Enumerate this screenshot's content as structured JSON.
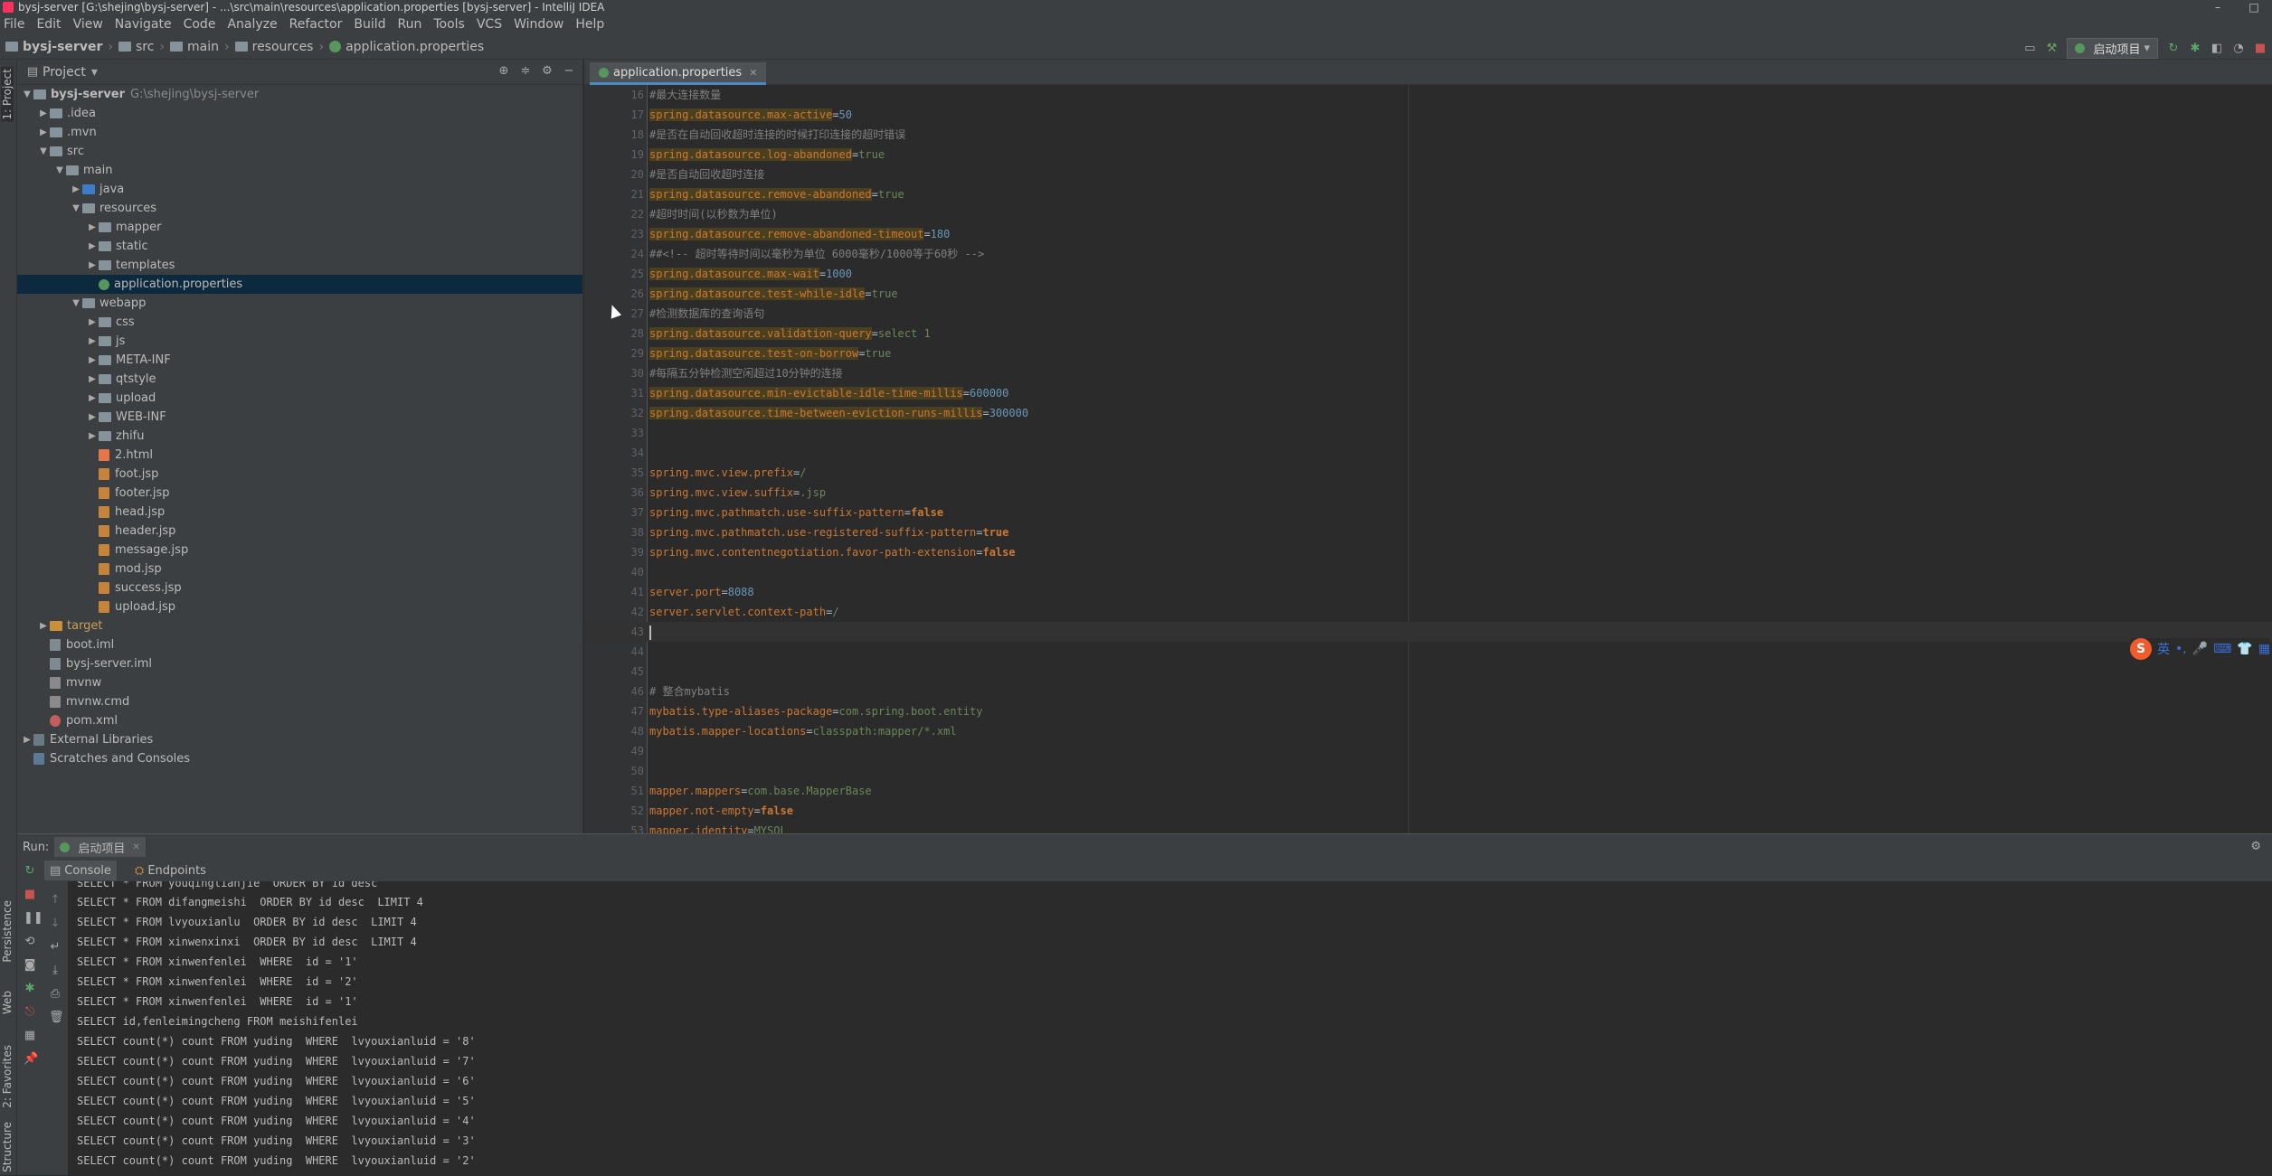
{
  "window": {
    "title": "bysj-server [G:\\shejing\\bysj-server] - ...\\src\\main\\resources\\application.properties [bysj-server] - IntelliJ IDEA",
    "min": "–",
    "close": "□"
  },
  "menu": [
    "File",
    "Edit",
    "View",
    "Navigate",
    "Code",
    "Analyze",
    "Refactor",
    "Build",
    "Run",
    "Tools",
    "VCS",
    "Window",
    "Help"
  ],
  "breadcrumb": [
    "bysj-server",
    "src",
    "main",
    "resources",
    "application.properties"
  ],
  "run_config": "启动项目",
  "left_tools": [
    "1: Project",
    "Persistence",
    "Web",
    "2: Favorites",
    "Structure"
  ],
  "project_panel": {
    "title": "Project",
    "tree": [
      {
        "name": "bysj-server",
        "path": "G:\\shejing\\bysj-server",
        "indent": 0,
        "type": "root"
      },
      {
        "name": ".idea",
        "indent": 1,
        "type": "folder"
      },
      {
        "name": ".mvn",
        "indent": 1,
        "type": "folder"
      },
      {
        "name": "src",
        "indent": 1,
        "type": "folder-open"
      },
      {
        "name": "main",
        "indent": 2,
        "type": "folder-open"
      },
      {
        "name": "java",
        "indent": 3,
        "type": "folder-blue"
      },
      {
        "name": "resources",
        "indent": 3,
        "type": "folder-open"
      },
      {
        "name": "mapper",
        "indent": 4,
        "type": "folder"
      },
      {
        "name": "static",
        "indent": 4,
        "type": "folder"
      },
      {
        "name": "templates",
        "indent": 4,
        "type": "folder-leaf"
      },
      {
        "name": "application.properties",
        "indent": 4,
        "type": "properties",
        "selected": true
      },
      {
        "name": "webapp",
        "indent": 3,
        "type": "folder-open"
      },
      {
        "name": "css",
        "indent": 4,
        "type": "folder"
      },
      {
        "name": "js",
        "indent": 4,
        "type": "folder"
      },
      {
        "name": "META-INF",
        "indent": 4,
        "type": "folder"
      },
      {
        "name": "qtstyle",
        "indent": 4,
        "type": "folder"
      },
      {
        "name": "upload",
        "indent": 4,
        "type": "folder"
      },
      {
        "name": "WEB-INF",
        "indent": 4,
        "type": "folder"
      },
      {
        "name": "zhifu",
        "indent": 4,
        "type": "folder"
      },
      {
        "name": "2.html",
        "indent": 4,
        "type": "html"
      },
      {
        "name": "foot.jsp",
        "indent": 4,
        "type": "jsp"
      },
      {
        "name": "footer.jsp",
        "indent": 4,
        "type": "jsp"
      },
      {
        "name": "head.jsp",
        "indent": 4,
        "type": "jsp"
      },
      {
        "name": "header.jsp",
        "indent": 4,
        "type": "jsp"
      },
      {
        "name": "message.jsp",
        "indent": 4,
        "type": "jsp"
      },
      {
        "name": "mod.jsp",
        "indent": 4,
        "type": "jsp"
      },
      {
        "name": "success.jsp",
        "indent": 4,
        "type": "jsp"
      },
      {
        "name": "upload.jsp",
        "indent": 4,
        "type": "jsp"
      },
      {
        "name": "target",
        "indent": 1,
        "type": "folder-orange"
      },
      {
        "name": "boot.iml",
        "indent": 1,
        "type": "iml"
      },
      {
        "name": "bysj-server.iml",
        "indent": 1,
        "type": "iml"
      },
      {
        "name": "mvnw",
        "indent": 1,
        "type": "mvn"
      },
      {
        "name": "mvnw.cmd",
        "indent": 1,
        "type": "mvn"
      },
      {
        "name": "pom.xml",
        "indent": 1,
        "type": "xml"
      },
      {
        "name": "External Libraries",
        "indent": 0,
        "type": "lib"
      },
      {
        "name": "Scratches and Consoles",
        "indent": 0,
        "type": "scratch"
      }
    ]
  },
  "editor_tab": "application.properties",
  "code_lines": [
    {
      "n": "16",
      "parts": [
        [
          "c",
          "#最大连接数量"
        ]
      ]
    },
    {
      "n": "17",
      "parts": [
        [
          "kh",
          "spring.datasource.max-active"
        ],
        [
          "eq",
          "="
        ],
        [
          "n",
          "50"
        ]
      ]
    },
    {
      "n": "18",
      "parts": [
        [
          "c",
          "#是否在自动回收超时连接的时候打印连接的超时错误"
        ]
      ]
    },
    {
      "n": "19",
      "parts": [
        [
          "kh",
          "spring.datasource.log-abandoned"
        ],
        [
          "eq",
          "="
        ],
        [
          "v",
          "true"
        ]
      ]
    },
    {
      "n": "20",
      "parts": [
        [
          "c",
          "#是否自动回收超时连接"
        ]
      ]
    },
    {
      "n": "21",
      "parts": [
        [
          "kh",
          "spring.datasource.remove-abandoned"
        ],
        [
          "eq",
          "="
        ],
        [
          "v",
          "true"
        ]
      ]
    },
    {
      "n": "22",
      "parts": [
        [
          "c",
          "#超时时间(以秒数为单位)"
        ]
      ]
    },
    {
      "n": "23",
      "parts": [
        [
          "kh",
          "spring.datasource.remove-abandoned-timeout"
        ],
        [
          "eq",
          "="
        ],
        [
          "n",
          "180"
        ]
      ]
    },
    {
      "n": "24",
      "parts": [
        [
          "c",
          "##<!-- 超时等待时间以毫秒为单位 6000毫秒/1000等于60秒 -->"
        ]
      ]
    },
    {
      "n": "25",
      "parts": [
        [
          "kh",
          "spring.datasource.max-wait"
        ],
        [
          "eq",
          "="
        ],
        [
          "n",
          "1000"
        ]
      ]
    },
    {
      "n": "26",
      "parts": [
        [
          "kh",
          "spring.datasource.test-while-idle"
        ],
        [
          "eq",
          "="
        ],
        [
          "v",
          "true"
        ]
      ]
    },
    {
      "n": "27",
      "parts": [
        [
          "c",
          "#检测数据库的查询语句"
        ]
      ]
    },
    {
      "n": "28",
      "parts": [
        [
          "kh",
          "spring.datasource.validation-query"
        ],
        [
          "eq",
          "="
        ],
        [
          "v",
          "select 1"
        ]
      ]
    },
    {
      "n": "29",
      "parts": [
        [
          "kh",
          "spring.datasource.test-on-borrow"
        ],
        [
          "eq",
          "="
        ],
        [
          "v",
          "true"
        ]
      ]
    },
    {
      "n": "30",
      "parts": [
        [
          "c",
          "#每隔五分钟检测空闲超过10分钟的连接"
        ]
      ]
    },
    {
      "n": "31",
      "parts": [
        [
          "kh",
          "spring.datasource.min-evictable-idle-time-millis"
        ],
        [
          "eq",
          "="
        ],
        [
          "n",
          "600000"
        ]
      ]
    },
    {
      "n": "32",
      "parts": [
        [
          "kh",
          "spring.datasource.time-between-eviction-runs-millis"
        ],
        [
          "eq",
          "="
        ],
        [
          "n",
          "300000"
        ]
      ]
    },
    {
      "n": "33",
      "parts": []
    },
    {
      "n": "34",
      "parts": []
    },
    {
      "n": "35",
      "parts": [
        [
          "k",
          "spring.mvc.view.prefix"
        ],
        [
          "eq",
          "="
        ],
        [
          "v",
          "/"
        ]
      ]
    },
    {
      "n": "36",
      "parts": [
        [
          "k",
          "spring.mvc.view.suffix"
        ],
        [
          "eq",
          "="
        ],
        [
          "v",
          ".jsp"
        ]
      ]
    },
    {
      "n": "37",
      "parts": [
        [
          "k",
          "spring.mvc.pathmatch.use-suffix-pattern"
        ],
        [
          "eq",
          "="
        ],
        [
          "b",
          "false"
        ]
      ]
    },
    {
      "n": "38",
      "parts": [
        [
          "k",
          "spring.mvc.pathmatch.use-registered-suffix-pattern"
        ],
        [
          "eq",
          "="
        ],
        [
          "b",
          "true"
        ]
      ]
    },
    {
      "n": "39",
      "parts": [
        [
          "k",
          "spring.mvc.contentnegotiation.favor-path-extension"
        ],
        [
          "eq",
          "="
        ],
        [
          "b",
          "false"
        ]
      ]
    },
    {
      "n": "40",
      "parts": []
    },
    {
      "n": "41",
      "parts": [
        [
          "k",
          "server.port"
        ],
        [
          "eq",
          "="
        ],
        [
          "n",
          "8088"
        ]
      ]
    },
    {
      "n": "42",
      "parts": [
        [
          "k",
          "server.servlet.context-path"
        ],
        [
          "eq",
          "="
        ],
        [
          "v",
          "/"
        ]
      ]
    },
    {
      "n": "43",
      "parts": [],
      "cursor": true
    },
    {
      "n": "44",
      "parts": []
    },
    {
      "n": "45",
      "parts": []
    },
    {
      "n": "46",
      "parts": [
        [
          "c",
          "# 整合mybatis"
        ]
      ]
    },
    {
      "n": "47",
      "parts": [
        [
          "k",
          "mybatis.type-aliases-package"
        ],
        [
          "eq",
          "="
        ],
        [
          "v",
          "com.spring.boot.entity"
        ]
      ]
    },
    {
      "n": "48",
      "parts": [
        [
          "k",
          "mybatis.mapper-locations"
        ],
        [
          "eq",
          "="
        ],
        [
          "v",
          "classpath:mapper/*.xml"
        ]
      ]
    },
    {
      "n": "49",
      "parts": []
    },
    {
      "n": "50",
      "parts": []
    },
    {
      "n": "51",
      "parts": [
        [
          "k",
          "mapper.mappers"
        ],
        [
          "eq",
          "="
        ],
        [
          "v",
          "com.base.MapperBase"
        ]
      ]
    },
    {
      "n": "52",
      "parts": [
        [
          "k",
          "mapper.not-empty"
        ],
        [
          "eq",
          "="
        ],
        [
          "b",
          "false"
        ]
      ]
    },
    {
      "n": "53",
      "parts": [
        [
          "k",
          "mapper.identity"
        ],
        [
          "eq",
          "="
        ],
        [
          "v",
          "MYSQL"
        ]
      ]
    }
  ],
  "ime": {
    "badge": "S",
    "lang": "英"
  },
  "run_panel": {
    "label": "Run:",
    "tab": "启动项目",
    "subtabs": [
      "Console",
      "Endpoints"
    ],
    "lines": [
      "SELECT * FROM youqinglianjie  ORDER BY id desc",
      "SELECT * FROM difangmeishi  ORDER BY id desc  LIMIT 4",
      "SELECT * FROM lvyouxianlu  ORDER BY id desc  LIMIT 4",
      "SELECT * FROM xinwenxinxi  ORDER BY id desc  LIMIT 4",
      "SELECT * FROM xinwenfenlei  WHERE  id = '1'",
      "SELECT * FROM xinwenfenlei  WHERE  id = '2'",
      "SELECT * FROM xinwenfenlei  WHERE  id = '1'",
      "SELECT id,fenleimingcheng FROM meishifenlei",
      "SELECT count(*) count FROM yuding  WHERE  lvyouxianluid = '8'",
      "SELECT count(*) count FROM yuding  WHERE  lvyouxianluid = '7'",
      "SELECT count(*) count FROM yuding  WHERE  lvyouxianluid = '6'",
      "SELECT count(*) count FROM yuding  WHERE  lvyouxianluid = '5'",
      "SELECT count(*) count FROM yuding  WHERE  lvyouxianluid = '4'",
      "SELECT count(*) count FROM yuding  WHERE  lvyouxianluid = '3'",
      "SELECT count(*) count FROM yuding  WHERE  lvyouxianluid = '2'"
    ]
  }
}
